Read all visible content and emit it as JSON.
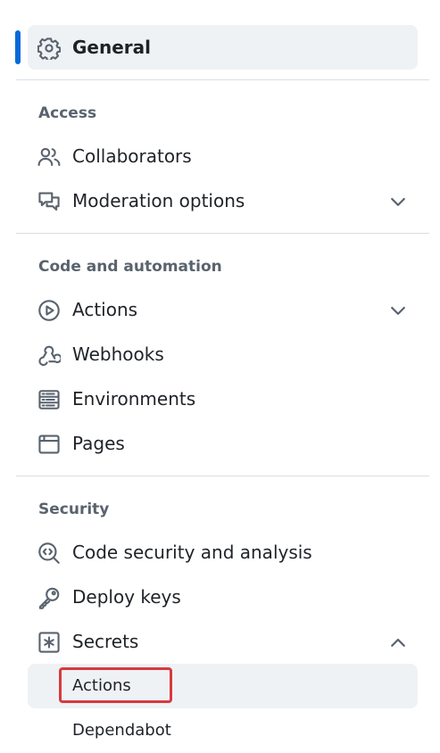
{
  "general": {
    "label": "General",
    "icon": "gear-icon"
  },
  "sections": {
    "access": {
      "heading": "Access",
      "items": [
        {
          "label": "Collaborators",
          "icon": "people-icon"
        },
        {
          "label": "Moderation options",
          "icon": "comment-discussion-icon",
          "chevron": "chevron-down-icon"
        }
      ]
    },
    "code_automation": {
      "heading": "Code and automation",
      "items": [
        {
          "label": "Actions",
          "icon": "play-icon",
          "chevron": "chevron-down-icon"
        },
        {
          "label": "Webhooks",
          "icon": "webhook-icon"
        },
        {
          "label": "Environments",
          "icon": "server-icon"
        },
        {
          "label": "Pages",
          "icon": "browser-icon"
        }
      ]
    },
    "security": {
      "heading": "Security",
      "items": [
        {
          "label": "Code security and analysis",
          "icon": "codescan-icon"
        },
        {
          "label": "Deploy keys",
          "icon": "key-icon"
        },
        {
          "label": "Secrets",
          "icon": "asterisk-icon",
          "chevron": "chevron-up-icon"
        }
      ],
      "secrets_subitems": [
        {
          "label": "Actions",
          "selected": true
        },
        {
          "label": "Dependabot",
          "selected": false
        }
      ]
    }
  },
  "colors": {
    "active_indicator": "#0969da",
    "selected_background": "#eff2f5",
    "highlight_border": "#d73a3f",
    "heading_text": "#59636e"
  }
}
